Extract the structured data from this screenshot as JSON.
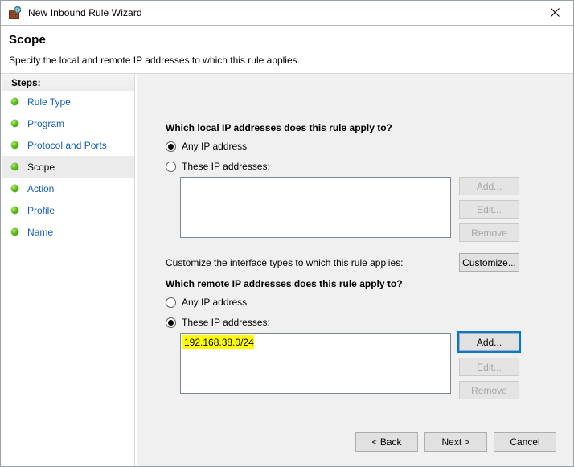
{
  "window": {
    "title": "New Inbound Rule Wizard",
    "icon": "firewall-globe-icon",
    "close_label": "✕"
  },
  "header": {
    "title": "Scope",
    "subtitle": "Specify the local and remote IP addresses to which this rule applies."
  },
  "sidebar": {
    "heading": "Steps:",
    "items": [
      {
        "label": "Rule Type",
        "current": false
      },
      {
        "label": "Program",
        "current": false
      },
      {
        "label": "Protocol and Ports",
        "current": false
      },
      {
        "label": "Scope",
        "current": true
      },
      {
        "label": "Action",
        "current": false
      },
      {
        "label": "Profile",
        "current": false
      },
      {
        "label": "Name",
        "current": false
      }
    ]
  },
  "main": {
    "local": {
      "question": "Which local IP addresses does this rule apply to?",
      "radio_any": "Any IP address",
      "radio_these": "These IP addresses:",
      "selected": "any",
      "list_items": [],
      "add_label": "Add...",
      "edit_label": "Edit...",
      "remove_label": "Remove",
      "add_enabled": false,
      "edit_enabled": false,
      "remove_enabled": false
    },
    "customize": {
      "text": "Customize the interface types to which this rule applies:",
      "button_label": "Customize..."
    },
    "remote": {
      "question": "Which remote IP addresses does this rule apply to?",
      "radio_any": "Any IP address",
      "radio_these": "These IP addresses:",
      "selected": "these",
      "list_items": [
        {
          "value": "192.168.38.0/24",
          "highlighted": true
        }
      ],
      "add_label": "Add...",
      "edit_label": "Edit...",
      "remove_label": "Remove",
      "add_enabled": true,
      "add_focused": true,
      "edit_enabled": false,
      "remove_enabled": false
    }
  },
  "footer": {
    "back_label": "< Back",
    "next_label": "Next >",
    "cancel_label": "Cancel"
  },
  "colors": {
    "link": "#1760b8",
    "highlight": "#ffff00",
    "focus_ring": "#0078d7",
    "panel_bg": "#f0f0f0"
  }
}
